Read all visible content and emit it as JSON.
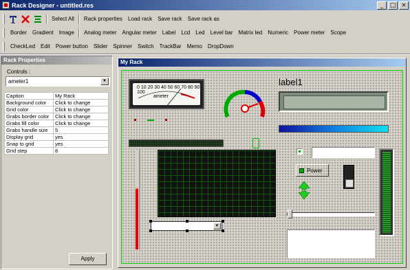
{
  "window": {
    "title": "Rack Designer - untitled.res",
    "buttons": [
      "_",
      "□",
      "×"
    ]
  },
  "toolbar1": {
    "items": [
      "Select All",
      "Rack properties",
      "Load rack",
      "Save rack",
      "Save rack as"
    ]
  },
  "toolbar2": {
    "items": [
      "Border",
      "Gradient",
      "Image",
      "Analog meter",
      "Angular meter",
      "Label",
      "Lcd",
      "Led",
      "Level bar",
      "Matrix led",
      "Numeric",
      "Power meter",
      "Scope"
    ]
  },
  "toolbar3": {
    "items": [
      "CheckLed",
      "Edit",
      "Power button",
      "Slider",
      "Spinner",
      "Switch",
      "TrackBar",
      "Memo",
      "DropDown"
    ]
  },
  "properties": {
    "title": "Rack Properties",
    "controls_label": "Controls :",
    "selected_control": "ameter1",
    "rows": [
      {
        "name": "Caption",
        "value": "My Rack"
      },
      {
        "name": "Background color",
        "value": "Click to change"
      },
      {
        "name": "Grid color",
        "value": "Click to change"
      },
      {
        "name": "Grabs border color",
        "value": "Click to change"
      },
      {
        "name": "Grabs fill color",
        "value": "Click to change"
      },
      {
        "name": "Grabs handle size",
        "value": "5"
      },
      {
        "name": "Display grid",
        "value": "yes"
      },
      {
        "name": "Snap to grid",
        "value": "yes"
      },
      {
        "name": "Grid step",
        "value": "8"
      }
    ],
    "apply_label": "Apply"
  },
  "rack": {
    "title": "My Rack",
    "meter_scale": "0 10 20 30 40 50 60 70 80 90 100",
    "meter_unit": "ameter",
    "label_text": "label1",
    "power_button_label": "Power"
  },
  "colors": {
    "grid_border": "#00cc00",
    "title_active": "#0a246a",
    "meter_needle": "#cc0000",
    "level_bar": "#10e0f0"
  }
}
